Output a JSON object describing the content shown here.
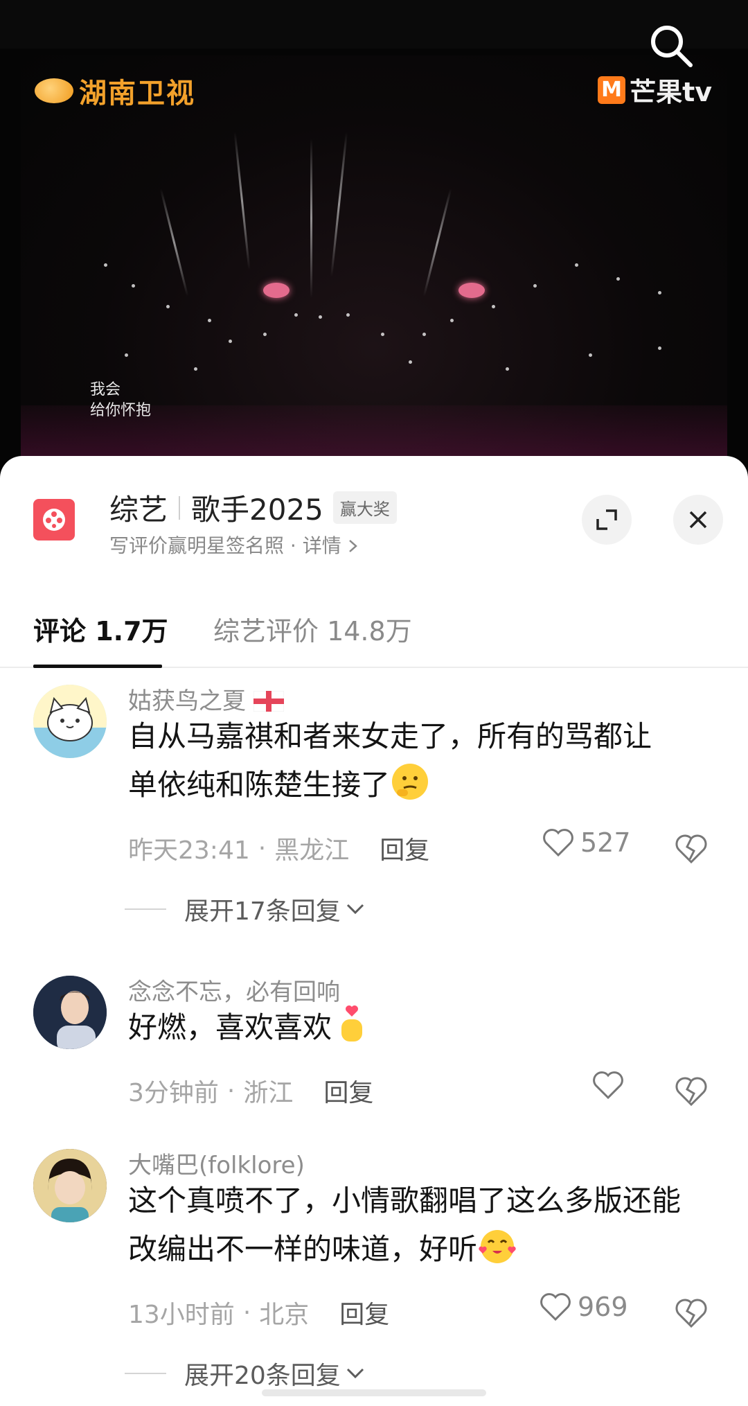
{
  "video": {
    "channel_logo": "湖南卫视",
    "platform_logo": "芒果tv",
    "subtitle_line1": "我会",
    "subtitle_line2": "给你怀抱",
    "search_icon": "search-icon"
  },
  "header": {
    "category": "综艺",
    "show_title": "歌手2025",
    "badge": "赢大奖",
    "subtitle": "写评价赢明星签名照 · 详情",
    "expand_icon": "expand-icon",
    "close_icon": "close-icon"
  },
  "tabs": [
    {
      "label": "评论 1.7万",
      "active": true
    },
    {
      "label": "综艺评价 14.8万",
      "active": false
    }
  ],
  "comments": [
    {
      "username": "姑获鸟之夏",
      "flag": "england-flag",
      "text_line1": "自从马嘉祺和者来女走了，所有的骂都让",
      "text_line2": "单依纯和陈楚生接了",
      "emoji": "thinking-face",
      "time": "昨天23:41",
      "location": "黑龙江",
      "reply": "回复",
      "likes": "527",
      "expand": "展开17条回复"
    },
    {
      "username": "念念不忘，必有回响",
      "text_line1": "好燃，喜欢喜欢",
      "emoji": "finger-heart",
      "time": "3分钟前",
      "location": "浙江",
      "reply": "回复",
      "likes": ""
    },
    {
      "username": "大嘴巴(folklore)",
      "text_line1": "这个真喷不了，小情歌翻唱了这么多版还能",
      "text_line2": "改编出不一样的味道，好听",
      "emoji": "smiling-face-with-hearts",
      "time": "13小时前",
      "location": "北京",
      "reply": "回复",
      "likes": "969",
      "expand": "展开20条回复"
    }
  ],
  "colors": {
    "accent": "#f4505c",
    "text_primary": "#141414",
    "text_secondary": "#8d8d8d"
  }
}
